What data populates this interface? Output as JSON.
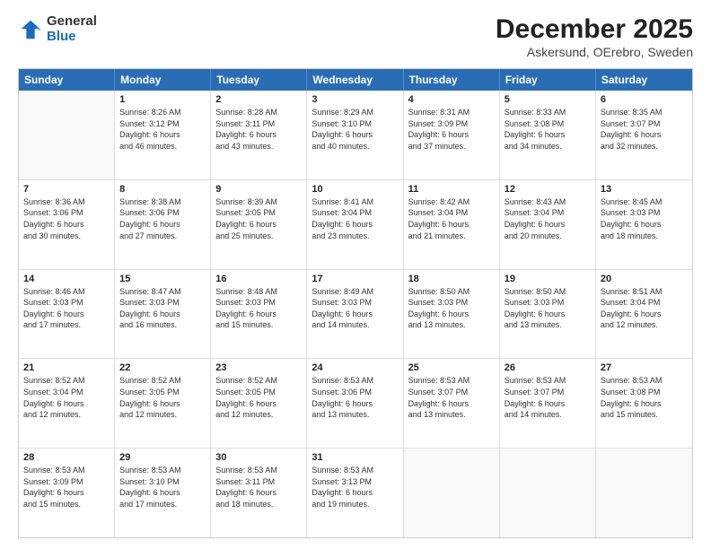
{
  "logo": {
    "general": "General",
    "blue": "Blue"
  },
  "title": "December 2025",
  "subtitle": "Askersund, OErebro, Sweden",
  "header_days": [
    "Sunday",
    "Monday",
    "Tuesday",
    "Wednesday",
    "Thursday",
    "Friday",
    "Saturday"
  ],
  "rows": [
    [
      {
        "day": "",
        "info": ""
      },
      {
        "day": "1",
        "info": "Sunrise: 8:26 AM\nSunset: 3:12 PM\nDaylight: 6 hours\nand 46 minutes."
      },
      {
        "day": "2",
        "info": "Sunrise: 8:28 AM\nSunset: 3:11 PM\nDaylight: 6 hours\nand 43 minutes."
      },
      {
        "day": "3",
        "info": "Sunrise: 8:29 AM\nSunset: 3:10 PM\nDaylight: 6 hours\nand 40 minutes."
      },
      {
        "day": "4",
        "info": "Sunrise: 8:31 AM\nSunset: 3:09 PM\nDaylight: 6 hours\nand 37 minutes."
      },
      {
        "day": "5",
        "info": "Sunrise: 8:33 AM\nSunset: 3:08 PM\nDaylight: 6 hours\nand 34 minutes."
      },
      {
        "day": "6",
        "info": "Sunrise: 8:35 AM\nSunset: 3:07 PM\nDaylight: 6 hours\nand 32 minutes."
      }
    ],
    [
      {
        "day": "7",
        "info": "Sunrise: 8:36 AM\nSunset: 3:06 PM\nDaylight: 6 hours\nand 30 minutes."
      },
      {
        "day": "8",
        "info": "Sunrise: 8:38 AM\nSunset: 3:06 PM\nDaylight: 6 hours\nand 27 minutes."
      },
      {
        "day": "9",
        "info": "Sunrise: 8:39 AM\nSunset: 3:05 PM\nDaylight: 6 hours\nand 25 minutes."
      },
      {
        "day": "10",
        "info": "Sunrise: 8:41 AM\nSunset: 3:04 PM\nDaylight: 6 hours\nand 23 minutes."
      },
      {
        "day": "11",
        "info": "Sunrise: 8:42 AM\nSunset: 3:04 PM\nDaylight: 6 hours\nand 21 minutes."
      },
      {
        "day": "12",
        "info": "Sunrise: 8:43 AM\nSunset: 3:04 PM\nDaylight: 6 hours\nand 20 minutes."
      },
      {
        "day": "13",
        "info": "Sunrise: 8:45 AM\nSunset: 3:03 PM\nDaylight: 6 hours\nand 18 minutes."
      }
    ],
    [
      {
        "day": "14",
        "info": "Sunrise: 8:46 AM\nSunset: 3:03 PM\nDaylight: 6 hours\nand 17 minutes."
      },
      {
        "day": "15",
        "info": "Sunrise: 8:47 AM\nSunset: 3:03 PM\nDaylight: 6 hours\nand 16 minutes."
      },
      {
        "day": "16",
        "info": "Sunrise: 8:48 AM\nSunset: 3:03 PM\nDaylight: 6 hours\nand 15 minutes."
      },
      {
        "day": "17",
        "info": "Sunrise: 8:49 AM\nSunset: 3:03 PM\nDaylight: 6 hours\nand 14 minutes."
      },
      {
        "day": "18",
        "info": "Sunrise: 8:50 AM\nSunset: 3:03 PM\nDaylight: 6 hours\nand 13 minutes."
      },
      {
        "day": "19",
        "info": "Sunrise: 8:50 AM\nSunset: 3:03 PM\nDaylight: 6 hours\nand 13 minutes."
      },
      {
        "day": "20",
        "info": "Sunrise: 8:51 AM\nSunset: 3:04 PM\nDaylight: 6 hours\nand 12 minutes."
      }
    ],
    [
      {
        "day": "21",
        "info": "Sunrise: 8:52 AM\nSunset: 3:04 PM\nDaylight: 6 hours\nand 12 minutes."
      },
      {
        "day": "22",
        "info": "Sunrise: 8:52 AM\nSunset: 3:05 PM\nDaylight: 6 hours\nand 12 minutes."
      },
      {
        "day": "23",
        "info": "Sunrise: 8:52 AM\nSunset: 3:05 PM\nDaylight: 6 hours\nand 12 minutes."
      },
      {
        "day": "24",
        "info": "Sunrise: 8:53 AM\nSunset: 3:06 PM\nDaylight: 6 hours\nand 13 minutes."
      },
      {
        "day": "25",
        "info": "Sunrise: 8:53 AM\nSunset: 3:07 PM\nDaylight: 6 hours\nand 13 minutes."
      },
      {
        "day": "26",
        "info": "Sunrise: 8:53 AM\nSunset: 3:07 PM\nDaylight: 6 hours\nand 14 minutes."
      },
      {
        "day": "27",
        "info": "Sunrise: 8:53 AM\nSunset: 3:08 PM\nDaylight: 6 hours\nand 15 minutes."
      }
    ],
    [
      {
        "day": "28",
        "info": "Sunrise: 8:53 AM\nSunset: 3:09 PM\nDaylight: 6 hours\nand 15 minutes."
      },
      {
        "day": "29",
        "info": "Sunrise: 8:53 AM\nSunset: 3:10 PM\nDaylight: 6 hours\nand 17 minutes."
      },
      {
        "day": "30",
        "info": "Sunrise: 8:53 AM\nSunset: 3:11 PM\nDaylight: 6 hours\nand 18 minutes."
      },
      {
        "day": "31",
        "info": "Sunrise: 8:53 AM\nSunset: 3:13 PM\nDaylight: 6 hours\nand 19 minutes."
      },
      {
        "day": "",
        "info": ""
      },
      {
        "day": "",
        "info": ""
      },
      {
        "day": "",
        "info": ""
      }
    ]
  ]
}
